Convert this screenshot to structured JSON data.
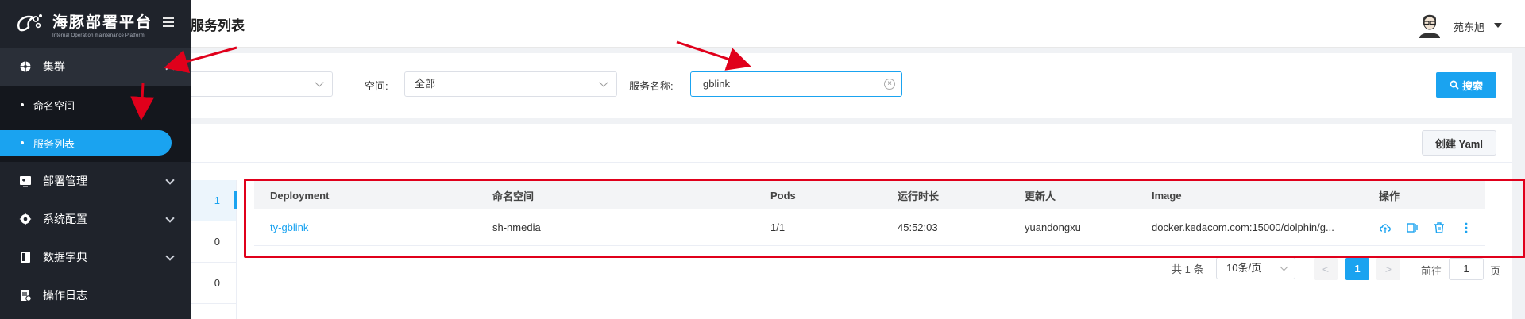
{
  "app": {
    "name": "海豚部署平台",
    "subtitle": "Internal Operation maintenance Platform"
  },
  "header": {
    "title": "服务列表",
    "user_name": "苑东旭"
  },
  "sidebar": {
    "groups": [
      {
        "label": "集群",
        "icon": "cluster-icon",
        "expanded": true,
        "children": [
          {
            "label": "命名空间",
            "active": false
          },
          {
            "label": "服务列表",
            "active": true
          }
        ]
      },
      {
        "label": "部署管理",
        "icon": "deploy-icon",
        "expanded": false
      },
      {
        "label": "系统配置",
        "icon": "gear-icon",
        "expanded": false
      },
      {
        "label": "数据字典",
        "icon": "book-icon",
        "expanded": false
      },
      {
        "label": "操作日志",
        "icon": "log-icon",
        "expanded": false
      }
    ]
  },
  "filters": {
    "space_label": "空间:",
    "space_value": "全部",
    "service_label": "服务名称:",
    "service_value": "gblink",
    "search_button": "搜索"
  },
  "toolbar": {
    "create_yaml": "创建 Yaml"
  },
  "namespace_counts": [
    "1",
    "0",
    "0"
  ],
  "table": {
    "columns": [
      "Deployment",
      "命名空间",
      "Pods",
      "运行时长",
      "更新人",
      "Image",
      "操作"
    ],
    "rows": [
      {
        "deployment": "ty-gblink",
        "namespace": "sh-nmedia",
        "pods": "1/1",
        "uptime": "45:52:03",
        "updater": "yuandongxu",
        "image": "docker.kedacom.com:15000/dolphin/g..."
      }
    ]
  },
  "pagination": {
    "total": "共 1 条",
    "page_size": "10条/页",
    "prev": "<",
    "current": "1",
    "next": ">",
    "goto_label": "前往",
    "goto_value": "1",
    "goto_suffix": "页"
  },
  "colors": {
    "accent": "#1aa3f0",
    "sidebar_bg": "#1f232b",
    "highlight_red": "#e0001b"
  }
}
